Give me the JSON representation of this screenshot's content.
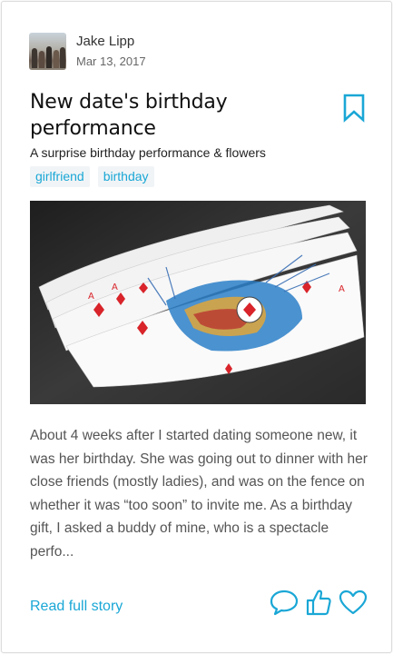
{
  "post": {
    "author_name": "Jake Lipp",
    "date": "Mar 13, 2017",
    "title": "New date's birthday performance",
    "subtitle": "A surprise birthday performance & flowers",
    "tags": [
      "girlfriend",
      "birthday"
    ],
    "excerpt": "About 4 weeks after I started dating someone new, it was her birthday. She was going out to dinner with her close friends (mostly ladies), and was on the fence on whether it was “too soon” to invite me. As a birthday gift, I asked a buddy of mine, who is a spectacle perfo...",
    "read_more_label": "Read full story"
  },
  "icons": {
    "bookmark": "bookmark-icon",
    "comment": "comment-icon",
    "like": "thumbs-up-icon",
    "favorite": "heart-icon"
  },
  "colors": {
    "accent": "#1aa7d6",
    "tag_background": "#f1f4f6",
    "text": "#222222",
    "muted_text": "#555555"
  }
}
